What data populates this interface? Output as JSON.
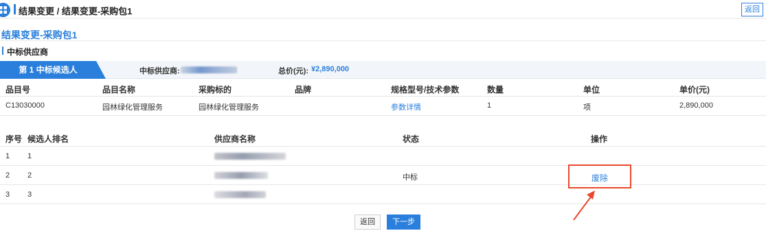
{
  "header": {
    "breadcrumb": "结果变更 / 结果变更-采购包1",
    "back_label": "返回",
    "menu_icon": "grid-icon"
  },
  "page_title": "结果变更-采购包1",
  "section_title": "中标供应商",
  "candidate_bar": {
    "tab_label": "第 1 中标候选人",
    "winner_label": "中标供应商:",
    "price_label": "总价(元):",
    "price_value": "¥2,890,000"
  },
  "items": {
    "headers": [
      "品目号",
      "品目名称",
      "采购标的",
      "品牌",
      "规格型号/技术参数",
      "数量",
      "单位",
      "单价(元)"
    ],
    "rows": [
      {
        "code": "C13030000",
        "name": "园林绿化管理服务",
        "subject": "园林绿化管理服务",
        "brand": "",
        "spec": "参数详情",
        "qty": "1",
        "unit": "项",
        "price": "2,890,000"
      }
    ]
  },
  "candidates": {
    "headers": [
      "序号",
      "候选人排名",
      "供应商名称",
      "状态",
      "操作"
    ],
    "rows": [
      {
        "seq": "1",
        "rank": "1",
        "status": "",
        "action": ""
      },
      {
        "seq": "2",
        "rank": "2",
        "status": "中标",
        "action": "废除"
      },
      {
        "seq": "3",
        "rank": "3",
        "status": "",
        "action": ""
      }
    ]
  },
  "footer": {
    "back_label": "返回",
    "next_label": "下一步"
  },
  "colors": {
    "accent": "#2a7fdc",
    "highlight": "#e8492b"
  }
}
